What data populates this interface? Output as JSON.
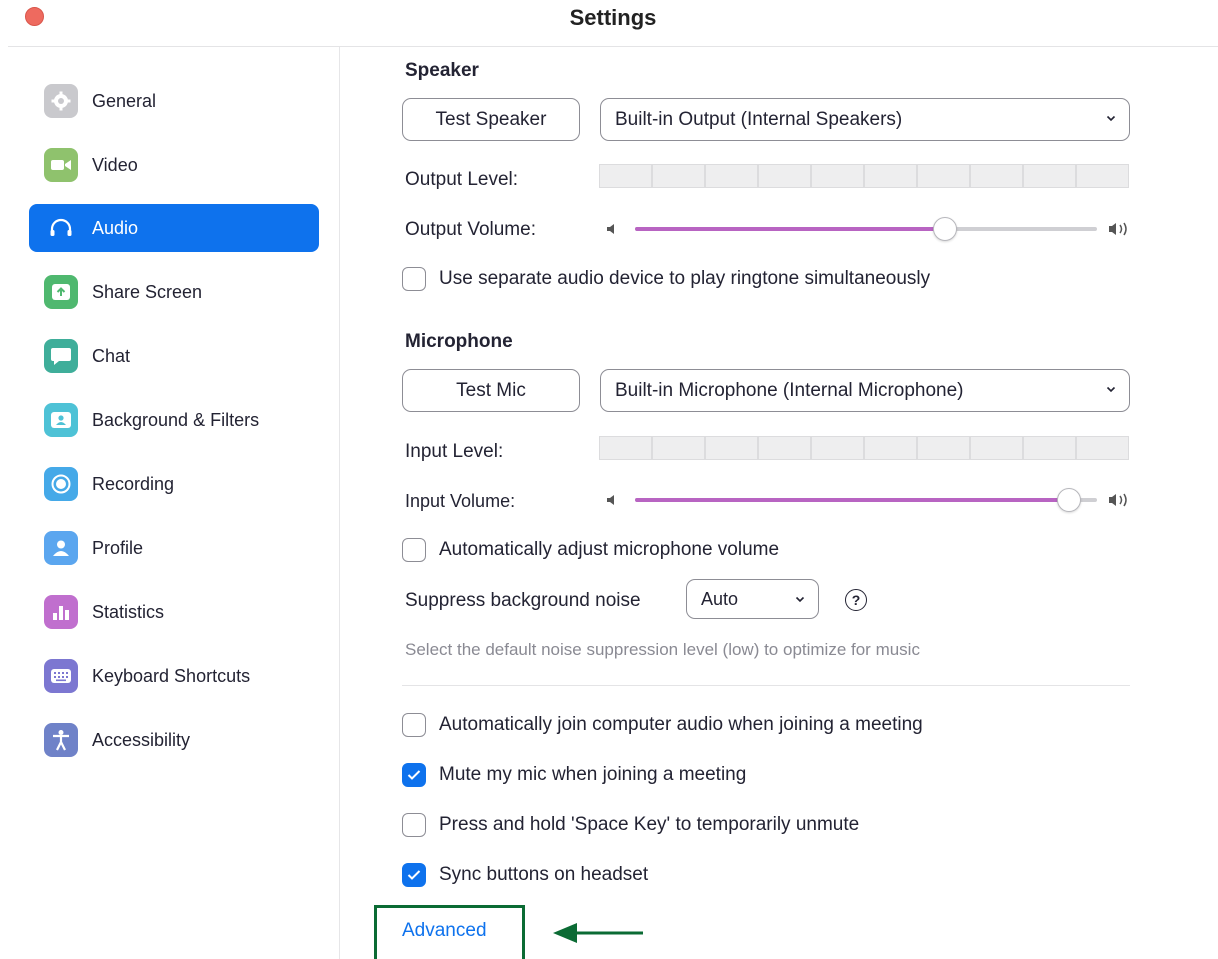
{
  "window": {
    "title": "Settings"
  },
  "sidebar": {
    "items": [
      {
        "label": "General",
        "icon": "gear-icon",
        "color": "#c9c9cd"
      },
      {
        "label": "Video",
        "icon": "video-camera-icon",
        "color": "#8fc26d"
      },
      {
        "label": "Audio",
        "icon": "headphones-icon",
        "color": "#0e72ed",
        "active": true
      },
      {
        "label": "Share Screen",
        "icon": "share-screen-icon",
        "color": "#4fb86f"
      },
      {
        "label": "Chat",
        "icon": "chat-bubble-icon",
        "color": "#3fae9a"
      },
      {
        "label": "Background & Filters",
        "icon": "background-person-icon",
        "color": "#4ec2d6"
      },
      {
        "label": "Recording",
        "icon": "record-icon",
        "color": "#45a9e8"
      },
      {
        "label": "Profile",
        "icon": "profile-icon",
        "color": "#5ba6ef"
      },
      {
        "label": "Statistics",
        "icon": "bar-chart-icon",
        "color": "#c06fce"
      },
      {
        "label": "Keyboard Shortcuts",
        "icon": "keyboard-icon",
        "color": "#7c77d1"
      },
      {
        "label": "Accessibility",
        "icon": "accessibility-person-icon",
        "color": "#6f82c8"
      }
    ]
  },
  "speaker": {
    "title": "Speaker",
    "test_button": "Test Speaker",
    "device": "Built-in Output (Internal Speakers)",
    "output_level_label": "Output Level:",
    "output_volume_label": "Output Volume:",
    "volume": 0.67,
    "separate_device_label": "Use separate audio device to play ringtone simultaneously",
    "separate_device_checked": false
  },
  "microphone": {
    "title": "Microphone",
    "test_button": "Test Mic",
    "device": "Built-in Microphone (Internal Microphone)",
    "input_level_label": "Input Level:",
    "input_volume_label": "Input Volume:",
    "volume": 0.94,
    "auto_adjust_label": "Automatically adjust microphone volume",
    "auto_adjust_checked": false,
    "suppress_label": "Suppress background noise",
    "suppress_value": "Auto",
    "suppress_hint": "Select the default noise suppression level (low) to optimize for music"
  },
  "options": [
    {
      "label": "Automatically join computer audio when joining a meeting",
      "checked": false
    },
    {
      "label": "Mute my mic when joining a meeting",
      "checked": true
    },
    {
      "label": "Press and hold 'Space Key' to temporarily unmute",
      "checked": false
    },
    {
      "label": "Sync buttons on headset",
      "checked": true
    }
  ],
  "advanced_link": "Advanced",
  "colors": {
    "accent": "#0e72ed",
    "slider_fill": "#b864c2",
    "highlight_box": "#0b6b34"
  }
}
